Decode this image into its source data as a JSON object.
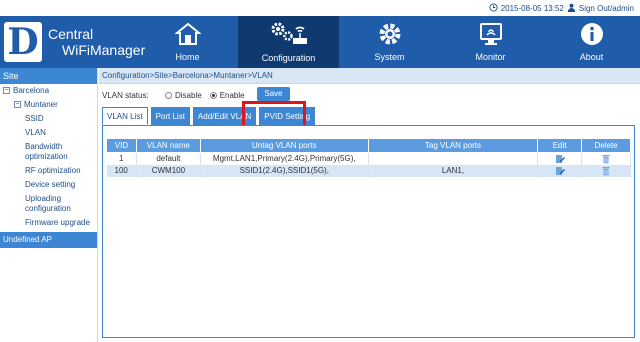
{
  "top": {
    "datetime": "2015-08-05 13:52",
    "sign_out": "Sign Out/admin"
  },
  "brand": {
    "letter": "D",
    "line1": "Central",
    "line2": "WiFiManager"
  },
  "nav": [
    {
      "label": "Home",
      "icon": "home-icon"
    },
    {
      "label": "Configuration",
      "icon": "configuration-icon",
      "active": true
    },
    {
      "label": "System",
      "icon": "system-gear-icon"
    },
    {
      "label": "Monitor",
      "icon": "monitor-icon"
    },
    {
      "label": "About",
      "icon": "info-icon"
    }
  ],
  "sidebar": {
    "site_header": "Site",
    "barcelona": "Barcelona",
    "muntaner": "Muntaner",
    "items": [
      "SSID",
      "VLAN",
      "Bandwidth optimization",
      "RF optimization",
      "Device setting",
      "Uploading configuration",
      "Firmware upgrade"
    ],
    "undefined_ap": "Undefined AP"
  },
  "breadcrumb": "Configuration>Site>Barcelona>Muntaner>VLAN",
  "vlan_status": {
    "label": "VLAN status:",
    "disable": "Disable",
    "enable": "Enable",
    "selected": "Enable"
  },
  "save_label": "Save",
  "tabs": [
    "VLAN List",
    "Port List",
    "Add/Edit VLAN",
    "PVID Setting"
  ],
  "table": {
    "headers": [
      "VID",
      "VLAN name",
      "Untag VLAN ports",
      "Tag VLAN ports",
      "Edit",
      "Delete"
    ],
    "rows": [
      {
        "vid": "1",
        "name": "default",
        "untag": "Mgmt,LAN1,Primary(2.4G),Primary(5G),",
        "tag": ""
      },
      {
        "vid": "100",
        "name": "CWM100",
        "untag": "SSID1(2.4G),SSID1(5G),",
        "tag": "LAN1,"
      }
    ]
  },
  "colors": {
    "header_bg": "#1f5ca9",
    "active_nav": "#0f3a70",
    "accent": "#3d86d4",
    "highlight": "#e0141c"
  }
}
